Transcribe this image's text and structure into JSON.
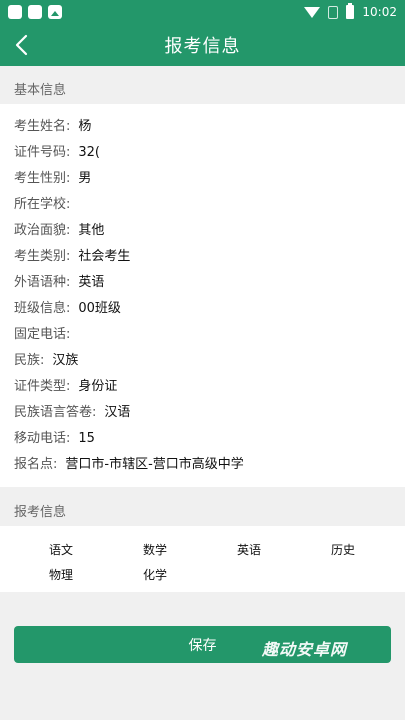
{
  "status_bar": {
    "time": "10:02"
  },
  "app_bar": {
    "title": "报考信息"
  },
  "basic": {
    "section_title": "基本信息",
    "rows": [
      {
        "label": "考生姓名:",
        "value": "杨"
      },
      {
        "label": "证件号码:",
        "value": "32("
      },
      {
        "label": "考生性别:",
        "value": "男"
      },
      {
        "label": "所在学校:",
        "value": ""
      },
      {
        "label": "政治面貌:",
        "value": "其他"
      },
      {
        "label": "考生类别:",
        "value": "社会考生"
      },
      {
        "label": "外语语种:",
        "value": "英语"
      },
      {
        "label": "班级信息:",
        "value": "00班级"
      },
      {
        "label": "固定电话:",
        "value": ""
      },
      {
        "label": "民族:",
        "value": "汉族"
      },
      {
        "label": "证件类型:",
        "value": "身份证"
      },
      {
        "label": "民族语言答卷:",
        "value": "汉语"
      },
      {
        "label": "移动电话:",
        "value": "15"
      },
      {
        "label": "报名点:",
        "value": "营口市-市辖区-营口市高级中学"
      }
    ]
  },
  "exam": {
    "section_title": "报考信息",
    "subjects": [
      "语文",
      "数学",
      "英语",
      "历史",
      "物理",
      "化学"
    ]
  },
  "save_button": {
    "label": "保存"
  },
  "watermark": "趣动安卓网"
}
